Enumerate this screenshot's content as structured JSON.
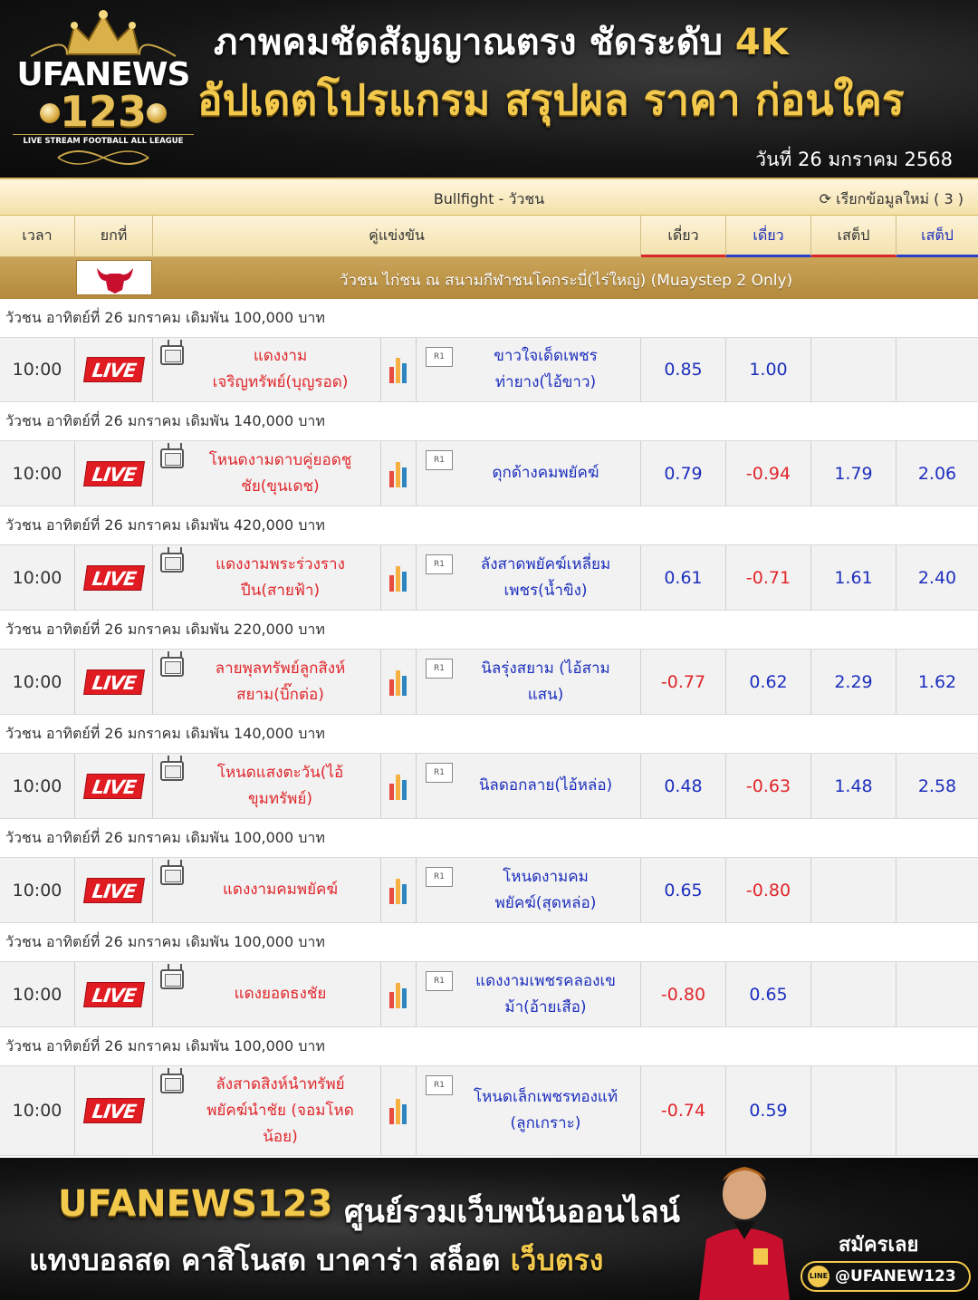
{
  "header": {
    "logo": {
      "brand": "UFANEWS",
      "number": "123",
      "tagline": "LIVE STREAM FOOTBALL ALL LEAGUE"
    },
    "headline1_part1": "ภาพคมชัดสัญญาณตรง ชัดระดับ ",
    "headline1_part2": "4K",
    "headline2": "อัปเดตโปรแกรม สรุปผล ราคา ก่อนใคร",
    "date": "วันที่  26 มกราคม 2568"
  },
  "table": {
    "league_title": "Bullfight - วัวชน",
    "refresh_label": "เรียกข้อมูลใหม่ ( 3 )",
    "columns": {
      "time": "เวลา",
      "round": "ยกที่",
      "match": "คู่แข่งขัน",
      "odds1": "เดี่ยว",
      "odds2": "เดี่ยว",
      "odds3": "เสต็ป",
      "odds4": "เสต็ป"
    },
    "league_name": "วัวชน ไก่ชน ณ สนามกีฬาชนโคกระบี่(ไร่ใหญ่) (Muaystep 2 Only)",
    "matches": [
      {
        "date_label": "วัวชน อาทิตย์ที่ 26 มกราคม เดิมพัน 100,000 บาท",
        "time": "10:00",
        "live": "LIVE",
        "home": "แดงงาม\nเจริญทรัพย์(บุญรอด)",
        "away": "ขาวใจเด็ดเพชร\nท่ายาง(ไอ้ขาว)",
        "o1": "0.85",
        "o2": "1.00",
        "o3": "",
        "o4": ""
      },
      {
        "date_label": "วัวชน อาทิตย์ที่ 26 มกราคม เดิมพัน 140,000 บาท",
        "time": "10:00",
        "live": "LIVE",
        "home": "โหนดงามดาบคู่ยอดชู\nชัย(ขุนเดช)",
        "away": "ดุกด้างคมพยัคฆ์",
        "o1": "0.79",
        "o2": "-0.94",
        "o3": "1.79",
        "o4": "2.06"
      },
      {
        "date_label": "วัวชน อาทิตย์ที่ 26 มกราคม เดิมพัน 420,000 บาท",
        "time": "10:00",
        "live": "LIVE",
        "home": "แดงงามพระร่วงราง\nปืน(สายฟ้า)",
        "away": "ลังสาดพยัคฆ์เหลี่ยม\nเพชร(น้ำขิง)",
        "o1": "0.61",
        "o2": "-0.71",
        "o3": "1.61",
        "o4": "2.40"
      },
      {
        "date_label": "วัวชน อาทิตย์ที่ 26 มกราคม เดิมพัน 220,000 บาท",
        "time": "10:00",
        "live": "LIVE",
        "home": "ลายพุลทรัพย์ลูกสิงห์\nสยาม(บิ๊กต่อ)",
        "away": "นิลรุ่งสยาม (ไอ้สาม\nแสน)",
        "o1": "-0.77",
        "o2": "0.62",
        "o3": "2.29",
        "o4": "1.62"
      },
      {
        "date_label": "วัวชน อาทิตย์ที่ 26 มกราคม เดิมพัน 140,000 บาท",
        "time": "10:00",
        "live": "LIVE",
        "home": "โหนดแสงตะวัน(ไอ้\nขุมทรัพย์)",
        "away": "นิลดอกลาย(ไอ้หล่อ)",
        "o1": "0.48",
        "o2": "-0.63",
        "o3": "1.48",
        "o4": "2.58"
      },
      {
        "date_label": "วัวชน อาทิตย์ที่ 26 มกราคม เดิมพัน 100,000 บาท",
        "time": "10:00",
        "live": "LIVE",
        "home": "แดงงามคมพยัคฆ์",
        "away": "โหนดงามคม\nพยัคฆ์(สุดหล่อ)",
        "o1": "0.65",
        "o2": "-0.80",
        "o3": "",
        "o4": ""
      },
      {
        "date_label": "วัวชน อาทิตย์ที่ 26 มกราคม เดิมพัน 100,000 บาท",
        "time": "10:00",
        "live": "LIVE",
        "home": "แดงยอดธงชัย",
        "away": "แดงงามเพชรคลองเข\nม้า(อ้ายเสือ)",
        "o1": "-0.80",
        "o2": "0.65",
        "o3": "",
        "o4": ""
      },
      {
        "date_label": "วัวชน อาทิตย์ที่ 26 มกราคม เดิมพัน 100,000 บาท",
        "time": "10:00",
        "live": "LIVE",
        "home": "ลังสาดสิงห์นำทรัพย์\nพยัคฆ์นำชัย (จอมโหด\nน้อย)",
        "away": "โหนดเล็กเพชรทองแท้\n(ลูกเกราะ)",
        "o1": "-0.74",
        "o2": "0.59",
        "o3": "",
        "o4": ""
      }
    ]
  },
  "footer": {
    "brand": "UFANEWS123",
    "slogan": "ศูนย์รวมเว็บพนันออนไลน์",
    "line2_part1": "แทงบอลสด คาสิโนสด บาคาร่า สล็อต ",
    "line2_part2": "เว็บตรง",
    "register": "สมัครเลย",
    "line_id": "@UFANEW123",
    "line_label": "LINE"
  },
  "colors": {
    "gold": "#f2c94c",
    "live_red": "#e01b22",
    "odds_blue": "#1d2fbd",
    "odds_red": "#e0262b",
    "league_bar": "#c9a458"
  }
}
